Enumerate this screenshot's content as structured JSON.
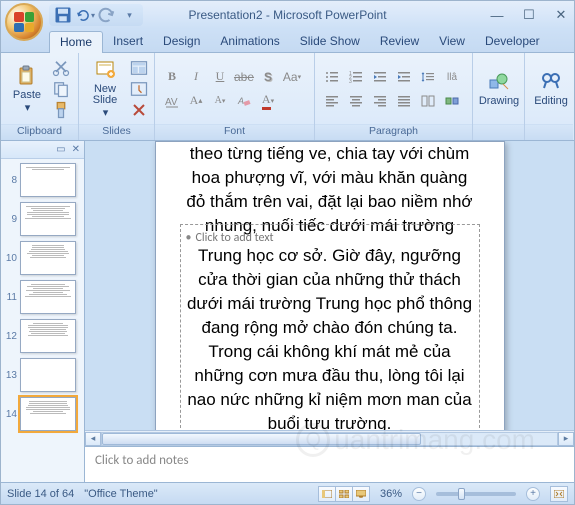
{
  "title": "Presentation2 - Microsoft PowerPoint",
  "tabs": [
    "Home",
    "Insert",
    "Design",
    "Animations",
    "Slide Show",
    "Review",
    "View",
    "Developer"
  ],
  "groups": {
    "clipboard": {
      "label": "Clipboard",
      "paste": "Paste"
    },
    "slides": {
      "label": "Slides",
      "new_slide": "New\nSlide"
    },
    "font": {
      "label": "Font"
    },
    "paragraph": {
      "label": "Paragraph"
    },
    "drawing": {
      "label": "Drawing"
    },
    "editing": {
      "label": "Editing"
    }
  },
  "thumbs": [
    8,
    9,
    10,
    11,
    12,
    13,
    14
  ],
  "selected_thumb": 14,
  "slide_text_top": "theo từng tiếng ve, chia tay với chùm hoa phượng vĩ, với màu khăn quàng đỏ thắm trên vai, đặt lại bao niềm nhớ nhung, nuối tiếc dưới mái trường",
  "placeholder": "Click to add text",
  "slide_text_bottom": "Trung học cơ sở. Giờ đây, ngưỡng cửa thời gian của những thử thách dưới mái trường Trung học phổ thông đang rộng mở chào đón chúng ta. Trong cái không khí mát mẻ của những cơn mưa đầu thu, lòng tôi lại nao nức những kỉ niệm mơn man của buổi tựu trường.",
  "notes_placeholder": "Click to add notes",
  "status": {
    "slide": "Slide 14 of 64",
    "theme": "\"Office Theme\"",
    "zoom": "36%"
  },
  "watermark": "uantrimang.com"
}
